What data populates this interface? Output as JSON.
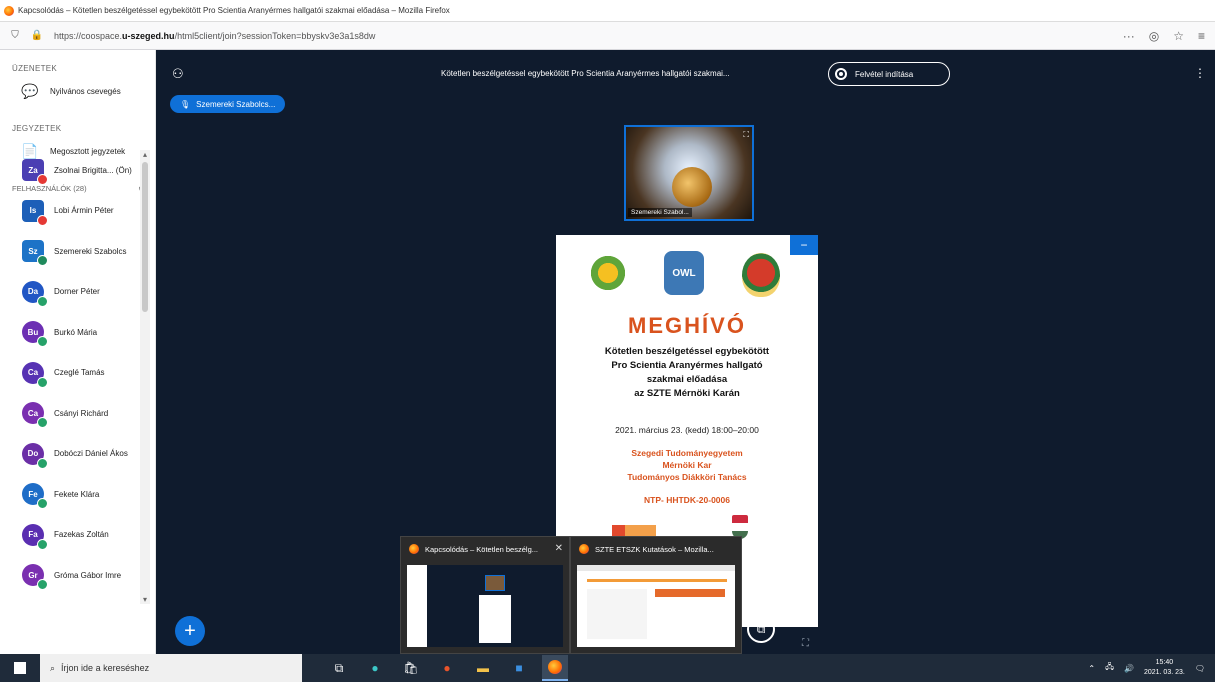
{
  "browser": {
    "title": "Kapcsolódás – Kötetlen beszélgetéssel egybekötött Pro Scientia Aranyérmes hallgatói szakmai előadása – Mozilla Firefox",
    "url_prefix": "https://coospace.",
    "url_domain": "u-szeged.hu",
    "url_rest": "/html5client/join?sessionToken=bbyskv3e3a1s8dw",
    "icons": [
      "reader-icon",
      "pocket-icon",
      "bookmark-star-icon",
      "menu-icon"
    ]
  },
  "sidebar": {
    "messages_title": "ÜZENETEK",
    "public_chat": "Nyilvános csevegés",
    "notes_title": "JEGYZETEK",
    "shared_notes": "Megosztott jegyzetek",
    "users_title": "FELHASZNÁLÓK (28)",
    "users": [
      {
        "initials": "Za",
        "name": "Zsolnai Brigitta... (Ön)",
        "color": "#4b3fb3",
        "badge_color": "#e53935",
        "round": false
      },
      {
        "initials": "Is",
        "name": "Lobi Ármin Péter",
        "color": "#1d5fb8",
        "badge_color": "#e53935",
        "round": false
      },
      {
        "initials": "Sz",
        "name": "Szemereki Szabolcs",
        "color": "#1d73c7",
        "badge_color": "#1f8a5c",
        "round": false
      },
      {
        "initials": "Da",
        "name": "Dorner Péter",
        "color": "#2156c4",
        "badge_color": "#26a269",
        "round": true
      },
      {
        "initials": "Bu",
        "name": "Burkó Mária",
        "color": "#6c2fb3",
        "badge_color": "#26a269",
        "round": true
      },
      {
        "initials": "Ca",
        "name": "Czeglé Tamás",
        "color": "#5732b3",
        "badge_color": "#26a269",
        "round": true
      },
      {
        "initials": "Ca",
        "name": "Csányi Richárd",
        "color": "#7a2fb0",
        "badge_color": "#26a269",
        "round": true
      },
      {
        "initials": "Do",
        "name": "Dobóczi Dániel Ákos",
        "color": "#6b2fa6",
        "badge_color": "#26a269",
        "round": true
      },
      {
        "initials": "Fe",
        "name": "Fekete Klára",
        "color": "#1f6dc7",
        "badge_color": "#26a269",
        "round": true
      },
      {
        "initials": "Fa",
        "name": "Fazekas Zoltán",
        "color": "#5a2eb1",
        "badge_color": "#26a269",
        "round": true
      },
      {
        "initials": "Gr",
        "name": "Gróma Gábor Imre",
        "color": "#7a2fb0",
        "badge_color": "#26a269",
        "round": true
      }
    ]
  },
  "meeting": {
    "title": "Kötetlen beszélgetéssel egybekötött Pro Scientia Aranyérmes hallgatói szakmai...",
    "record_label": "Felvétel indítása",
    "presenter_tag": "Szemereki Szabolcs...",
    "webcam_name": "Szemereki Szabol..."
  },
  "slide": {
    "logo_owl_text": "OWL",
    "heading": "MEGHÍVÓ",
    "subtitle_lines": [
      "Kötetlen beszélgetéssel egybekötött",
      "Pro Scientia Aranyérmes hallgató",
      "szakmai előadása",
      "az SZTE Mérnöki Karán"
    ],
    "date": "2021. március 23. (kedd) 18:00–20:00",
    "org_lines": [
      "Szegedi Tudományegyetem",
      "Mérnöki Kar",
      "Tudományos Diákköri Tanács"
    ],
    "ntp": "NTP- HHTDK-20-0006"
  },
  "previews": [
    {
      "title": "Kapcsolódás – Kötetlen beszélg..."
    },
    {
      "title": "SZTE ETSZK Kutatások – Mozilla..."
    }
  ],
  "taskbar": {
    "search_placeholder": "Írjon ide a kereséshez",
    "time": "15:40",
    "date": "2021. 03. 23."
  }
}
